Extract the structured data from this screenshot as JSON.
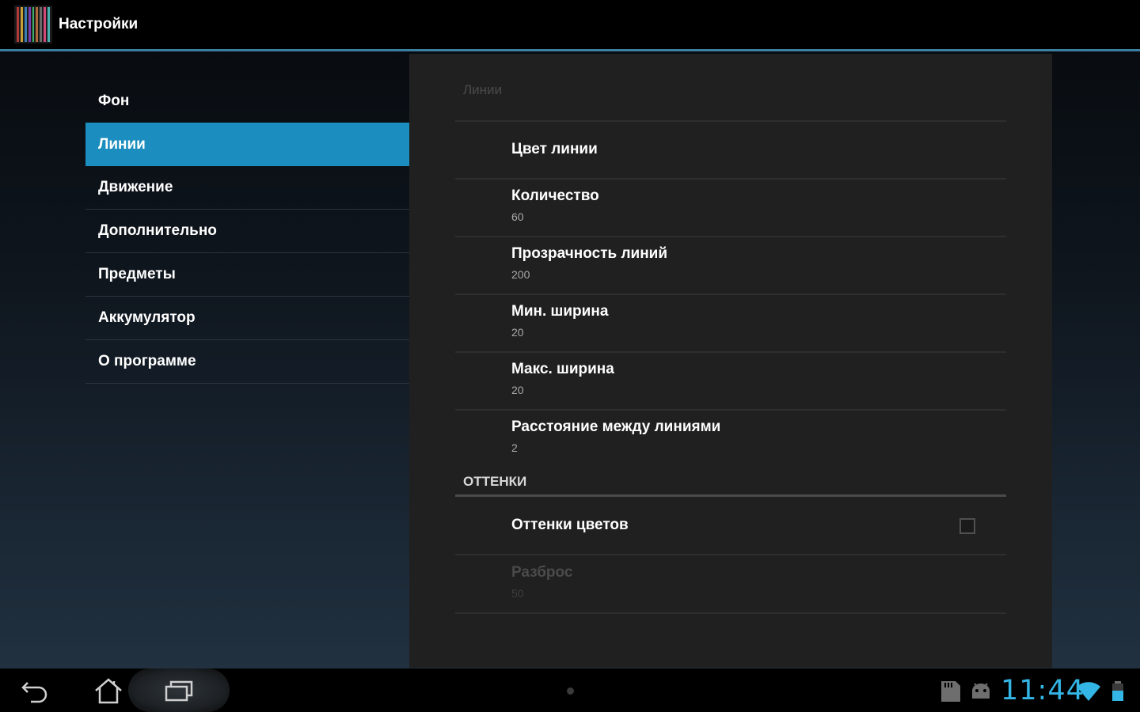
{
  "action_bar": {
    "title": "Настройки",
    "icon": "app-launcher-icon",
    "icon_stripe_colors": [
      "#b03a3a",
      "#c7a03a",
      "#3a7fb0",
      "#7a3ab0",
      "#3ab06a",
      "#b06a3a",
      "#6a6a6a",
      "#d04a7a",
      "#4ab0b0"
    ]
  },
  "sidebar": {
    "items": [
      {
        "label": "Фон",
        "selected": false
      },
      {
        "label": "Линии",
        "selected": true
      },
      {
        "label": "Движение",
        "selected": false
      },
      {
        "label": "Дополнительно",
        "selected": false
      },
      {
        "label": "Предметы",
        "selected": false
      },
      {
        "label": "Аккумулятор",
        "selected": false
      },
      {
        "label": "О программе",
        "selected": false
      }
    ]
  },
  "detail": {
    "breadcrumb": "Линии",
    "prefs": [
      {
        "title": "Цвет линии",
        "summary": ""
      },
      {
        "title": "Количество",
        "summary": "60"
      },
      {
        "title": "Прозрачность линий",
        "summary": "200"
      },
      {
        "title": "Мин. ширина",
        "summary": "20"
      },
      {
        "title": "Макс. ширина",
        "summary": "20"
      },
      {
        "title": "Расстояние между линиями",
        "summary": "2"
      }
    ],
    "category": "ОТТЕНКИ",
    "shades_pref": {
      "title": "Оттенки цветов",
      "checked": false
    },
    "spread_pref": {
      "title": "Разброс",
      "summary": "50",
      "enabled": false
    }
  },
  "system_bar": {
    "back_icon": "back-icon",
    "home_icon": "home-icon",
    "recents_icon": "recent-apps-icon",
    "sd_icon": "sd-card-icon",
    "android_icon": "android-debug-icon",
    "time": "11:44",
    "wifi_icon": "wifi-icon",
    "battery_icon": "battery-icon",
    "accent_color": "#33b5e5"
  },
  "colors": {
    "selected_item": "#1b8dbe",
    "action_bar_underline": "#3b7fa1",
    "panel_background": "#202020"
  }
}
